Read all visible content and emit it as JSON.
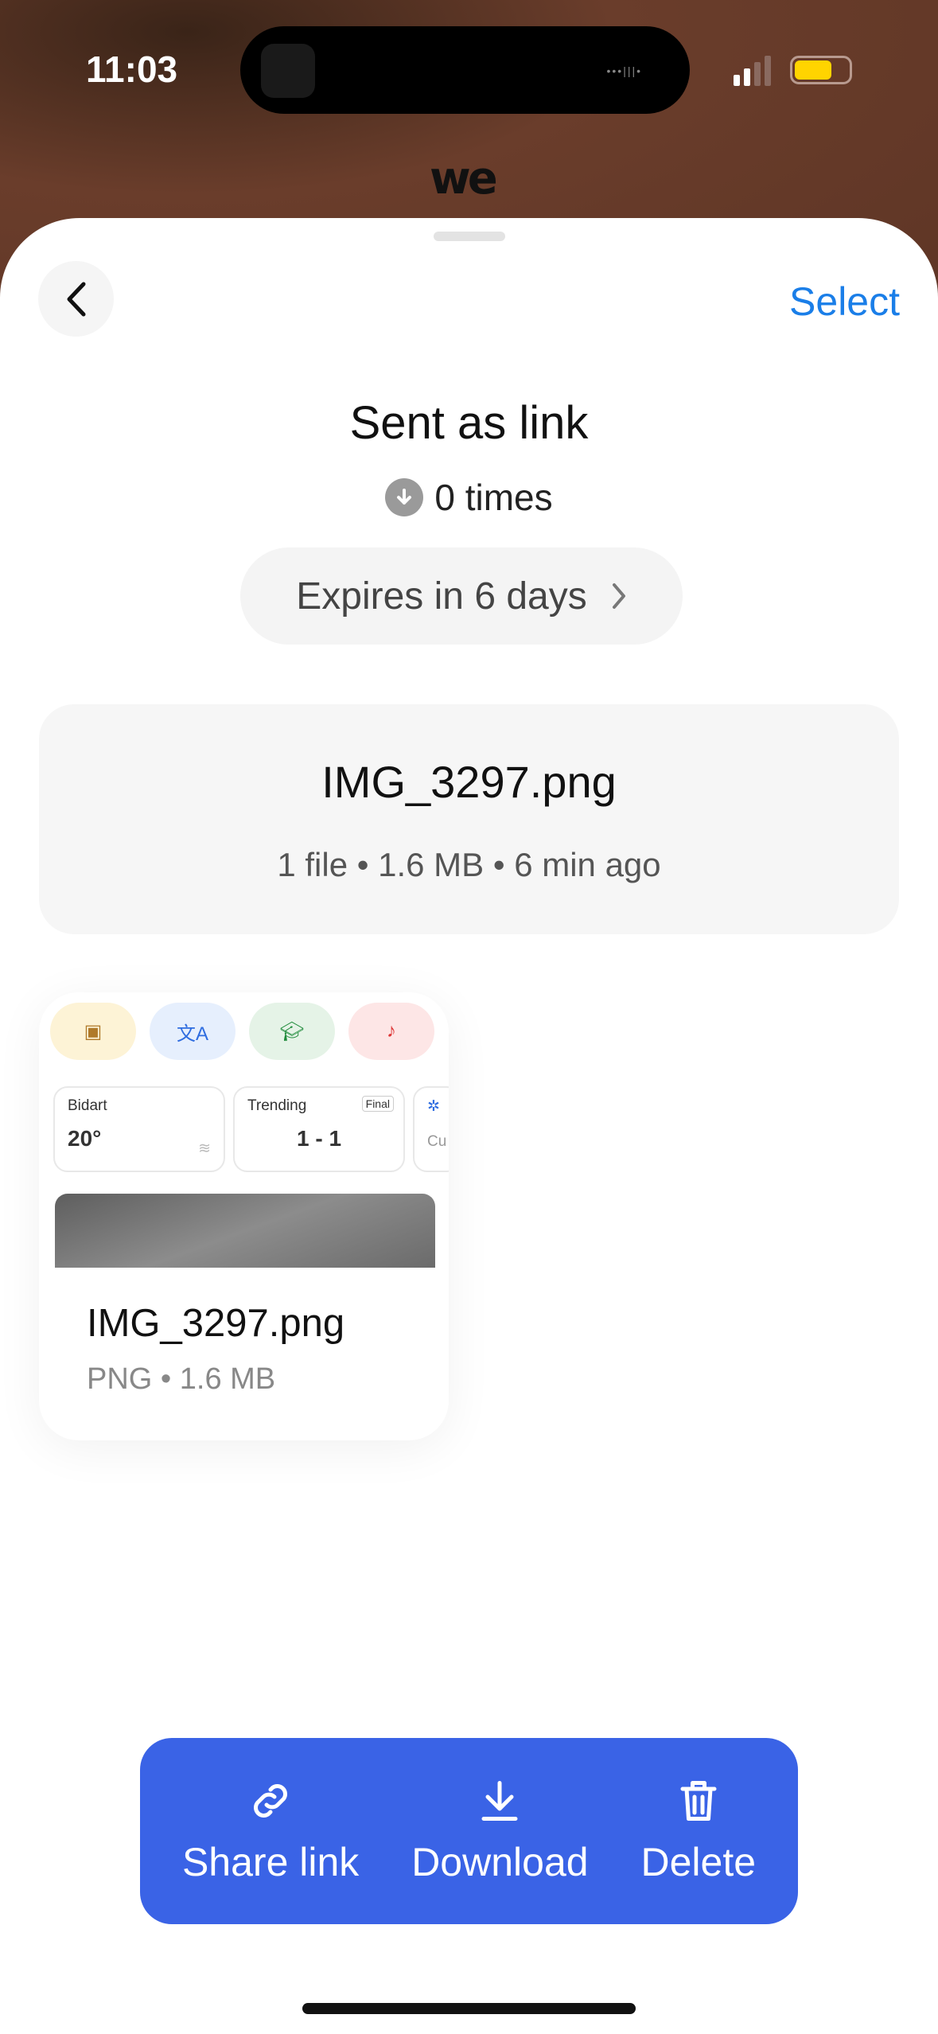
{
  "status_bar": {
    "time": "11:03",
    "signal_bars": 2,
    "battery_level": 0.7,
    "battery_color": "#ffd400"
  },
  "app": {
    "logo_text": "we",
    "accent": "#1a7ee8",
    "action_bar_color": "#3a63e6"
  },
  "header": {
    "back_icon": "chevron-left-icon",
    "select_label": "Select"
  },
  "transfer": {
    "title": "Sent as link",
    "download_icon": "download-circle-icon",
    "downloads": "0 times",
    "expires": "Expires in 6 days"
  },
  "file_summary": {
    "name": "IMG_3297.png",
    "meta": "1 file • 1.6 MB • 6 min ago"
  },
  "files": [
    {
      "name": "IMG_3297.png",
      "meta": "PNG • 1.6 MB",
      "preview": {
        "weather_city": "Bidart",
        "weather_temp": "20°",
        "trending_label": "Trending",
        "match_status": "Final",
        "score": "1 - 1",
        "cut_text": "Cu"
      }
    }
  ],
  "actions": [
    {
      "label": "Share link",
      "icon": "link-icon"
    },
    {
      "label": "Download",
      "icon": "download-icon"
    },
    {
      "label": "Delete",
      "icon": "trash-icon"
    }
  ]
}
